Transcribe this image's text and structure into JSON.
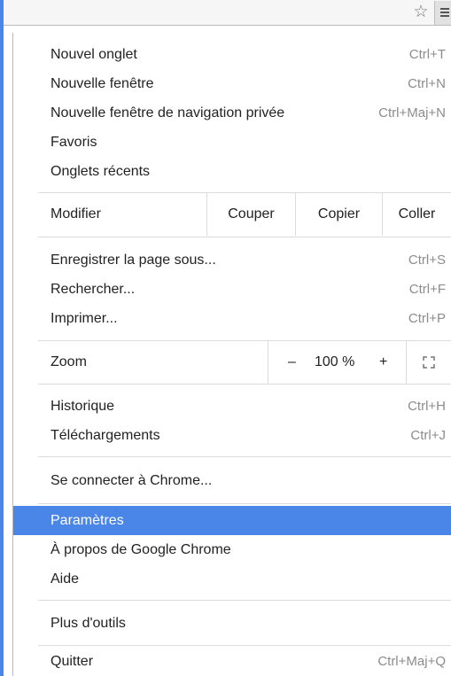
{
  "toolbar": {
    "star_icon": "star-outline-icon",
    "menu_icon": "hamburger-menu-icon"
  },
  "menu": {
    "new_tab": {
      "label": "Nouvel onglet",
      "shortcut": "Ctrl+T"
    },
    "new_window": {
      "label": "Nouvelle fenêtre",
      "shortcut": "Ctrl+N"
    },
    "incognito": {
      "label": "Nouvelle fenêtre de navigation privée",
      "shortcut": "Ctrl+Maj+N"
    },
    "bookmarks": {
      "label": "Favoris"
    },
    "recent_tabs": {
      "label": "Onglets récents"
    },
    "edit": {
      "label": "Modifier",
      "cut": "Couper",
      "copy": "Copier",
      "paste": "Coller"
    },
    "save_page": {
      "label": "Enregistrer la page sous...",
      "shortcut": "Ctrl+S"
    },
    "find": {
      "label": "Rechercher...",
      "shortcut": "Ctrl+F"
    },
    "print": {
      "label": "Imprimer...",
      "shortcut": "Ctrl+P"
    },
    "zoom": {
      "label": "Zoom",
      "minus": "–",
      "value": "100 %",
      "plus": "+"
    },
    "history": {
      "label": "Historique",
      "shortcut": "Ctrl+H"
    },
    "downloads": {
      "label": "Téléchargements",
      "shortcut": "Ctrl+J"
    },
    "sign_in": {
      "label": "Se connecter à Chrome..."
    },
    "settings": {
      "label": "Paramètres"
    },
    "about": {
      "label": "À propos de Google Chrome"
    },
    "help": {
      "label": "Aide"
    },
    "more_tools": {
      "label": "Plus d'outils"
    },
    "exit": {
      "label": "Quitter",
      "shortcut": "Ctrl+Maj+Q"
    }
  },
  "colors": {
    "selected": "#4a86e8",
    "separator": "#dcdcdc",
    "shortcut_text": "#8c8c8c"
  }
}
